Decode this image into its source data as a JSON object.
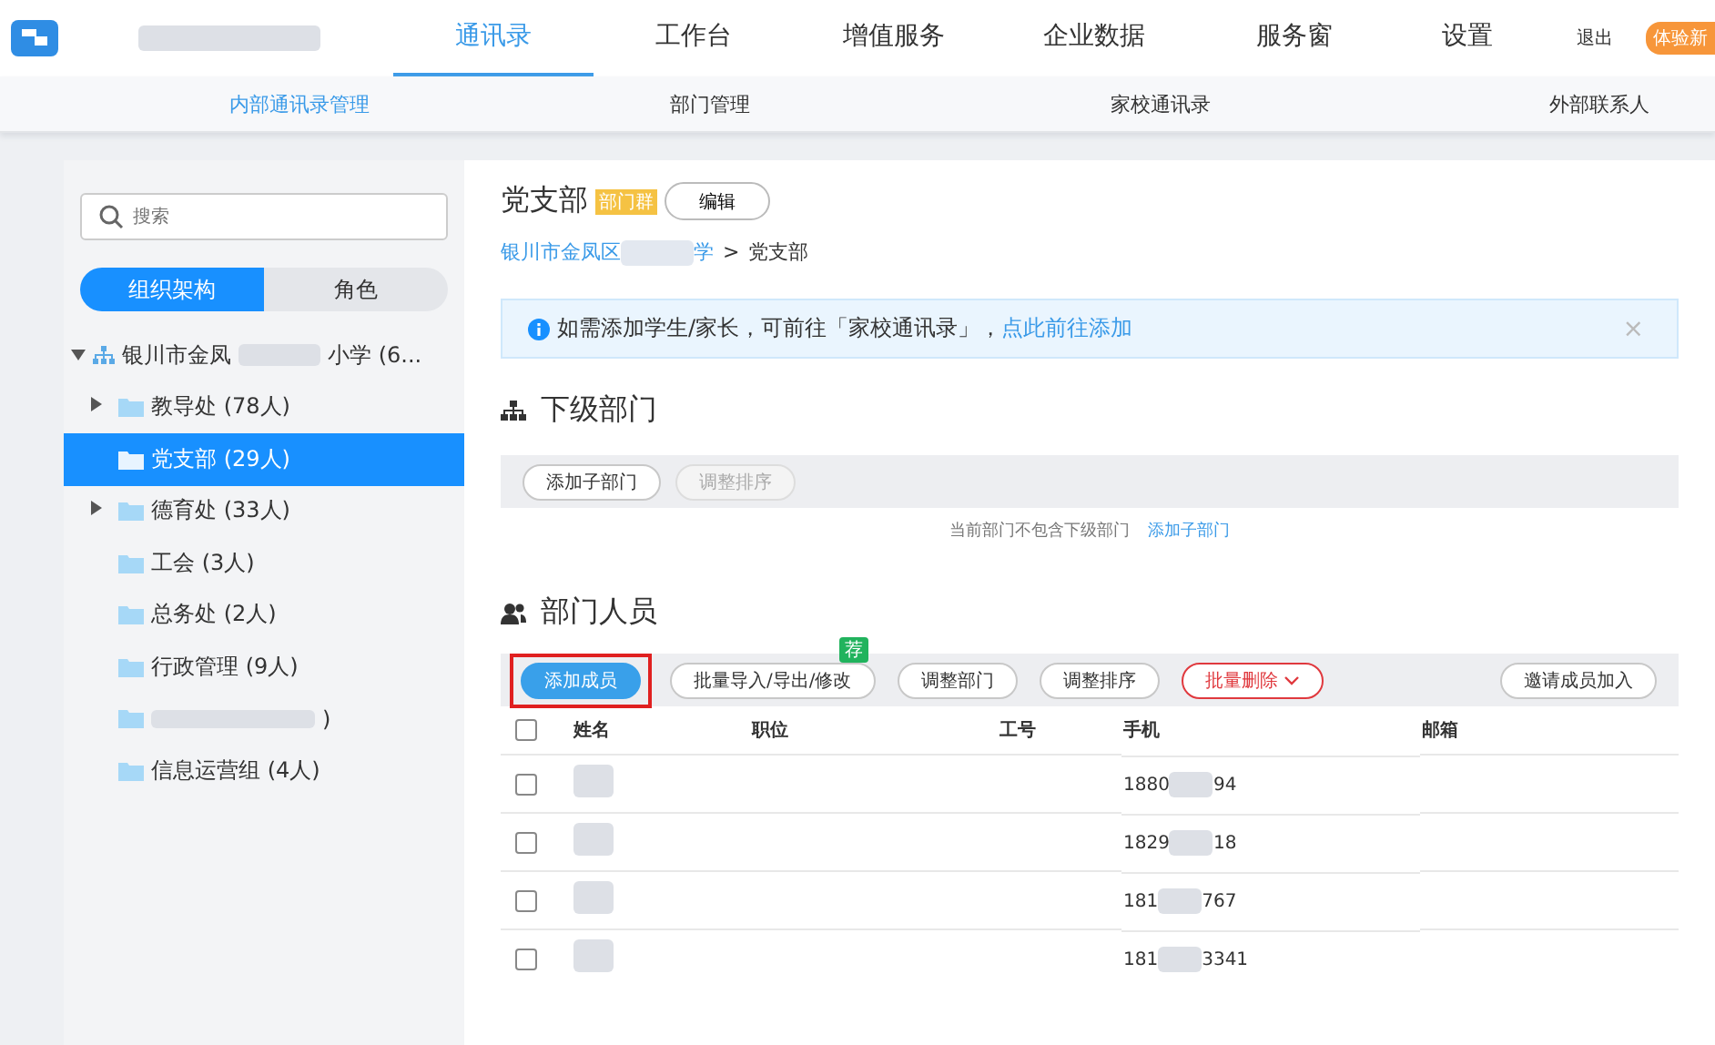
{
  "nav": {
    "tabs": [
      {
        "label": "通讯录",
        "selected": true
      },
      {
        "label": "工作台",
        "selected": false
      },
      {
        "label": "增值服务",
        "selected": false
      },
      {
        "label": "企业数据",
        "selected": false
      },
      {
        "label": "服务窗",
        "selected": false
      },
      {
        "label": "设置",
        "selected": false
      }
    ],
    "logout": "退出",
    "badge": "体验新"
  },
  "subnav": [
    {
      "label": "内部通讯录管理",
      "selected": true
    },
    {
      "label": "部门管理",
      "selected": false
    },
    {
      "label": "家校通讯录",
      "selected": false
    },
    {
      "label": "外部联系人",
      "selected": false
    }
  ],
  "sidebar": {
    "search": {
      "placeholder": "搜索"
    },
    "segments": [
      {
        "label": "组织架构",
        "selected": true
      },
      {
        "label": "角色",
        "selected": false
      }
    ],
    "tree": {
      "label_start": "银川市金凤",
      "label_end": "小学 (6...",
      "expanded": true,
      "children": [
        {
          "kind": "folder",
          "label": "教导处 (78人)",
          "has_children": true,
          "selected": false
        },
        {
          "kind": "folder",
          "label": "党支部 (29人)",
          "has_children": false,
          "selected": true
        },
        {
          "kind": "folder",
          "label": "德育处 (33人)",
          "has_children": true,
          "selected": false
        },
        {
          "kind": "folder",
          "label": "工会 (3人)",
          "has_children": false,
          "selected": false
        },
        {
          "kind": "folder",
          "label": "总务处 (2人)",
          "has_children": false,
          "selected": false
        },
        {
          "kind": "folder",
          "label": "行政管理 (9人)",
          "has_children": false,
          "selected": false
        },
        {
          "kind": "redacted",
          "label": ")",
          "has_children": false,
          "selected": false
        },
        {
          "kind": "folder",
          "label": "信息运营组 (4人)",
          "has_children": false,
          "selected": false
        }
      ]
    }
  },
  "main": {
    "title": "党支部",
    "tag": "部门群",
    "edit": "编辑",
    "breadcrumb": {
      "link_start": "银川市金凤区",
      "link_end": "学",
      "separator": ">",
      "current": "党支部"
    },
    "notice": {
      "text": "如需添加学生/家长，可前往「家校通讯录」，",
      "link": "点此前往添加",
      "close": "×"
    },
    "sub_departments": {
      "title": "下级部门",
      "buttons": [
        {
          "label": "添加子部门",
          "disabled": false
        },
        {
          "label": "调整排序",
          "disabled": true
        }
      ],
      "empty_text": "当前部门不包含下级部门",
      "empty_link": "添加子部门"
    },
    "members": {
      "title": "部门人员",
      "buttons": [
        {
          "label": "添加成员",
          "kind": "primary",
          "highlighted": true
        },
        {
          "label": "批量导入/导出/修改",
          "kind": "default",
          "highlighted": false,
          "badge": "荐"
        },
        {
          "label": "调整部门",
          "kind": "default",
          "highlighted": false
        },
        {
          "label": "调整排序",
          "kind": "default",
          "highlighted": false
        },
        {
          "label": "批量删除",
          "kind": "danger",
          "highlighted": false
        }
      ],
      "invite": "邀请成员加入",
      "columns": [
        "姓名",
        "职位",
        "工号",
        "手机",
        "邮箱"
      ],
      "header_checked": false,
      "rows": [
        {
          "checked": false,
          "phone_start": "1880",
          "phone_end": "94"
        },
        {
          "checked": false,
          "phone_start": "1829",
          "phone_end": "18"
        },
        {
          "checked": false,
          "phone_start": "181",
          "phone_end": "767"
        },
        {
          "checked": false,
          "phone_start": "181",
          "phone_end": "3341"
        }
      ]
    }
  }
}
